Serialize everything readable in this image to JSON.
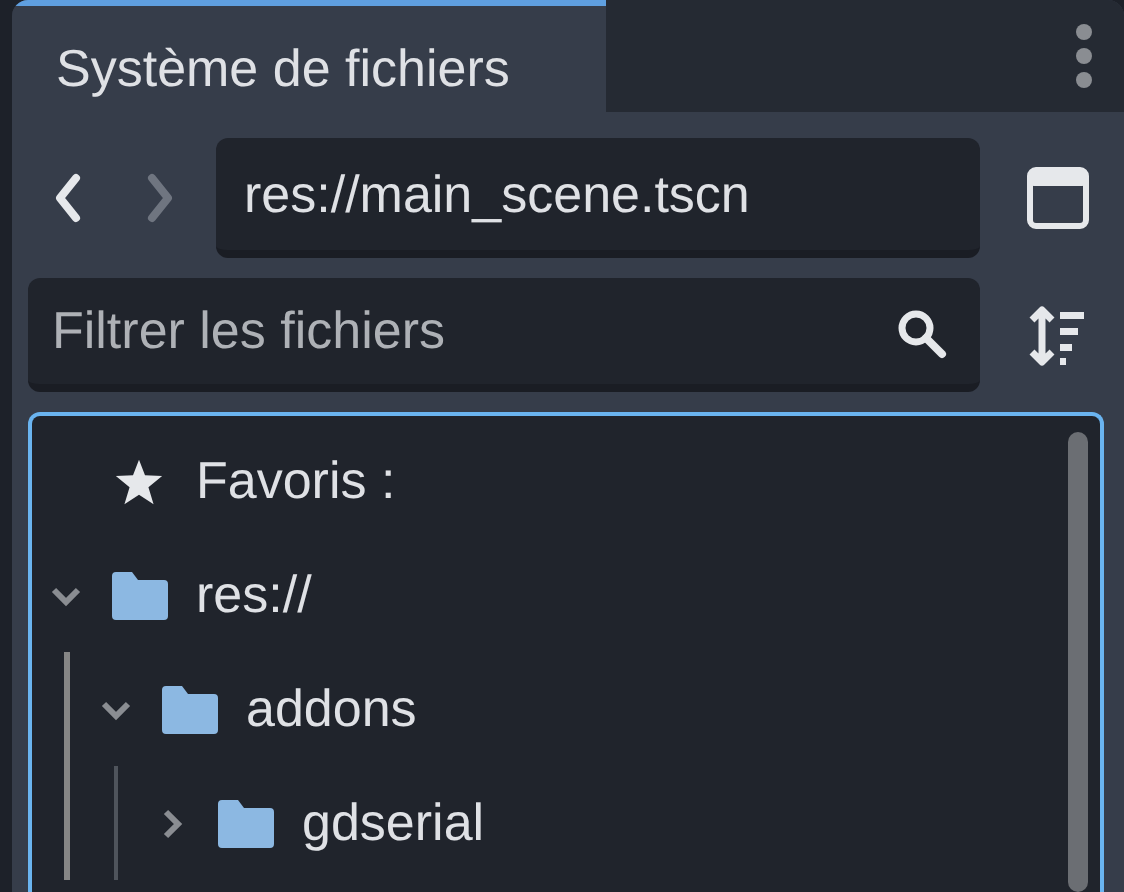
{
  "tab": {
    "label": "Système de fichiers",
    "selected": true
  },
  "navigation": [
    {
      "kind": "back",
      "disabled": false
    },
    {
      "kind": "forward",
      "disabled": true
    }
  ],
  "path_field": {
    "value": "res://main_scene.tscn"
  },
  "filter_field": {
    "placeholder": "Filtrer les fichiers"
  },
  "favorites": {
    "label": "Favoris :"
  },
  "tree": [
    {
      "name": "res://",
      "expanded": true,
      "children": [
        {
          "name": "addons",
          "expanded": true,
          "children": [
            {
              "name": "gdserial",
              "expanded": false
            }
          ]
        }
      ]
    }
  ]
}
